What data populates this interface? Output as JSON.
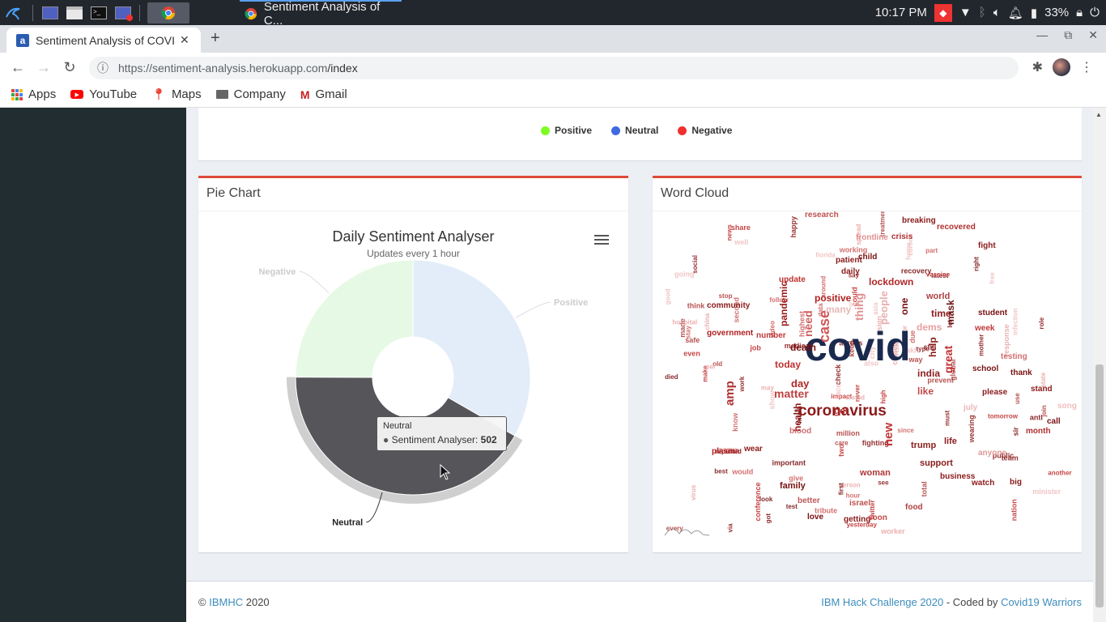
{
  "os": {
    "time": "10:17 PM",
    "battery": "33%",
    "task_title": "Sentiment Analysis of C..."
  },
  "browser": {
    "tab_title": "Sentiment Analysis of COVID",
    "url_domain": "https://sentiment-analysis.herokuapp.com",
    "url_path": "/index",
    "bookmarks": [
      {
        "label": "Apps"
      },
      {
        "label": "YouTube"
      },
      {
        "label": "Maps"
      },
      {
        "label": "Company"
      },
      {
        "label": "Gmail"
      }
    ]
  },
  "legend": [
    {
      "label": "Positive",
      "color": "#7cfc22"
    },
    {
      "label": "Neutral",
      "color": "#4169e1"
    },
    {
      "label": "Negative",
      "color": "#f03030"
    }
  ],
  "pie_card": {
    "heading": "Pie Chart"
  },
  "wordcloud_card": {
    "heading": "Word Cloud"
  },
  "chart_data": {
    "type": "pie",
    "title": "Daily Sentiment Analyser",
    "subtitle": "Updates every 1 hour",
    "series_name": "Sentiment Analyser",
    "slices": [
      {
        "name": "Positive",
        "value": 400,
        "color": "#e3edf9"
      },
      {
        "name": "Neutral",
        "value": 502,
        "color": "#56555a"
      },
      {
        "name": "Negative",
        "value": 300,
        "color": "#e6f9e4"
      }
    ],
    "inner_hole": true,
    "tooltip": {
      "category": "Neutral",
      "series": "Sentiment Analyser",
      "value": "502"
    }
  },
  "wordcloud": {
    "words": [
      {
        "t": "covid",
        "c": "#1a2a4e"
      },
      {
        "t": "coronavirus",
        "c": "#8b1a1a"
      },
      {
        "t": "matter",
        "c": "#c04040"
      },
      {
        "t": "amp",
        "c": "#b03030"
      },
      {
        "t": "case",
        "c": "#d05858"
      },
      {
        "t": "india",
        "c": "#8b2020"
      },
      {
        "t": "today",
        "c": "#c03030"
      },
      {
        "t": "day",
        "c": "#b02828"
      },
      {
        "t": "death",
        "c": "#7a1010"
      },
      {
        "t": "positive",
        "c": "#b02020"
      },
      {
        "t": "lockdown",
        "c": "#b02828"
      },
      {
        "t": "world",
        "c": "#b04040"
      },
      {
        "t": "time",
        "c": "#8b1a1a"
      },
      {
        "t": "pandemic",
        "c": "#9a1a1a"
      },
      {
        "t": "mask",
        "c": "#6a1010"
      },
      {
        "t": "dems",
        "c": "#e8a0a0"
      },
      {
        "t": "new",
        "c": "#c03838"
      },
      {
        "t": "great",
        "c": "#c03030"
      },
      {
        "t": "help",
        "c": "#8b1a1a"
      },
      {
        "t": "health",
        "c": "#8b1a1a"
      },
      {
        "t": "trump",
        "c": "#8b1a1a"
      },
      {
        "t": "need",
        "c": "#d06060"
      },
      {
        "t": "thing",
        "c": "#e09090"
      },
      {
        "t": "people",
        "c": "#e8b0b0"
      },
      {
        "t": "many",
        "c": "#e8b8b8"
      },
      {
        "t": "one",
        "c": "#7a1010"
      },
      {
        "t": "get",
        "c": "#b03030"
      },
      {
        "t": "like",
        "c": "#c04848"
      },
      {
        "t": "life",
        "c": "#8b1a1a"
      },
      {
        "t": "support",
        "c": "#8b1a1a"
      },
      {
        "t": "family",
        "c": "#7a1010"
      },
      {
        "t": "woman",
        "c": "#b03838"
      },
      {
        "t": "better",
        "c": "#c05858"
      },
      {
        "t": "love",
        "c": "#7a1010"
      },
      {
        "t": "getting",
        "c": "#8b1a1a"
      },
      {
        "t": "breaking",
        "c": "#8b1a1a"
      },
      {
        "t": "recovered",
        "c": "#b03030"
      },
      {
        "t": "fight",
        "c": "#8b1a1a"
      },
      {
        "t": "crisis",
        "c": "#b03030"
      },
      {
        "t": "research",
        "c": "#c05050"
      },
      {
        "t": "student",
        "c": "#7a1010"
      },
      {
        "t": "school",
        "c": "#7a1010"
      },
      {
        "t": "please",
        "c": "#8b1a1a"
      },
      {
        "t": "thank",
        "c": "#7a1010"
      },
      {
        "t": "testing",
        "c": "#d07070"
      },
      {
        "t": "community",
        "c": "#8b1a1a"
      },
      {
        "t": "government",
        "c": "#b02020"
      },
      {
        "t": "number",
        "c": "#c03838"
      },
      {
        "t": "blood",
        "c": "#d07070"
      },
      {
        "t": "update",
        "c": "#c03030"
      },
      {
        "t": "patient",
        "c": "#8b1a1a"
      },
      {
        "t": "daily",
        "c": "#8b1a1a"
      },
      {
        "t": "child",
        "c": "#7a1010"
      },
      {
        "t": "frontline",
        "c": "#e09090"
      },
      {
        "t": "week",
        "c": "#c03838"
      },
      {
        "t": "plasma",
        "c": "#b02020"
      },
      {
        "t": "wear",
        "c": "#8b1a1a"
      },
      {
        "t": "business",
        "c": "#8b1a1a"
      },
      {
        "t": "watch",
        "c": "#8b1a1a"
      },
      {
        "t": "food",
        "c": "#b04040"
      },
      {
        "t": "soon",
        "c": "#c04848"
      },
      {
        "t": "israel",
        "c": "#c05050"
      },
      {
        "t": "july",
        "c": "#e8b8b8"
      },
      {
        "t": "song",
        "c": "#f0c0c0"
      },
      {
        "t": "stand",
        "c": "#8b1a1a"
      },
      {
        "t": "month",
        "c": "#b03030"
      },
      {
        "t": "call",
        "c": "#7a1010"
      },
      {
        "t": "big",
        "c": "#8b1a1a"
      },
      {
        "t": "anyone",
        "c": "#e09898"
      }
    ]
  },
  "footer": {
    "copyright": "©",
    "org": "IBMHC",
    "year": "2020",
    "challenge": "IBM Hack Challenge 2020",
    "coded_by": " - Coded by ",
    "team": "Covid19 Warriors"
  }
}
